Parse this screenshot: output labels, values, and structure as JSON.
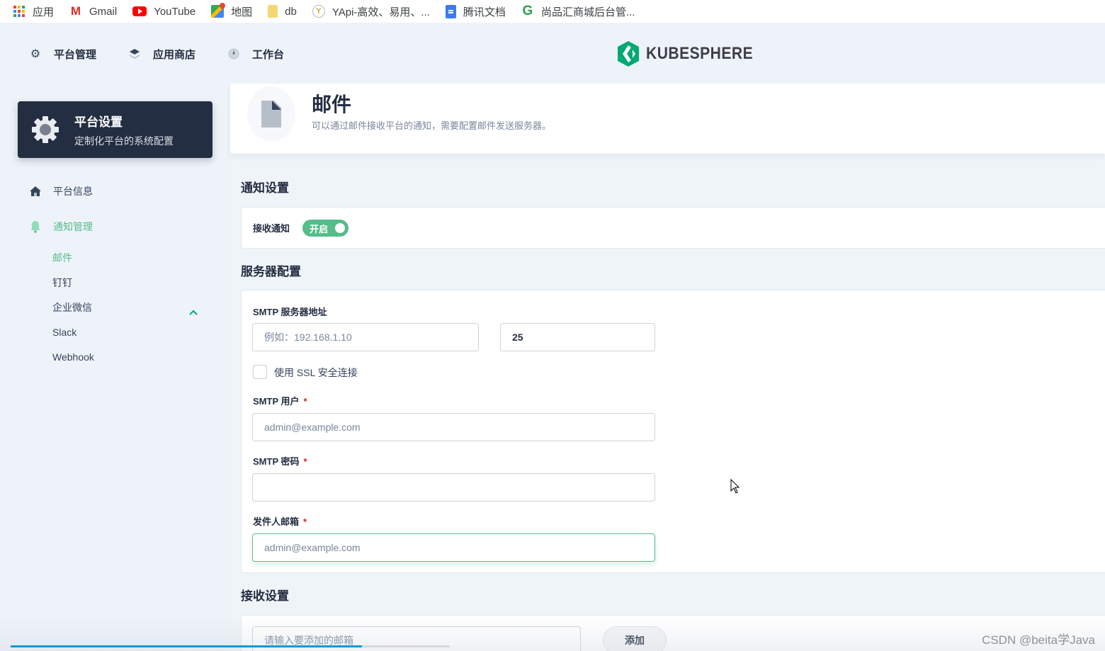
{
  "bookmarks": [
    {
      "label": "应用",
      "icon": "apps-grid-icon"
    },
    {
      "label": "Gmail",
      "icon": "gmail-icon"
    },
    {
      "label": "YouTube",
      "icon": "youtube-icon"
    },
    {
      "label": "地图",
      "icon": "maps-icon"
    },
    {
      "label": "db",
      "icon": "folder-icon"
    },
    {
      "label": "YApi-高效、易用、...",
      "icon": "yapi-icon"
    },
    {
      "label": "腾讯文档",
      "icon": "tencent-docs-icon"
    },
    {
      "label": "尚品汇商城后台管...",
      "icon": "site-favicon-icon"
    }
  ],
  "topnav": {
    "items": [
      {
        "label": "平台管理",
        "icon": "gear-icon"
      },
      {
        "label": "应用商店",
        "icon": "layers-icon"
      },
      {
        "label": "工作台",
        "icon": "dashboard-icon"
      }
    ],
    "logo_text": "KUBESPHERE"
  },
  "sidebar": {
    "card": {
      "title": "平台设置",
      "subtitle": "定制化平台的系统配置"
    },
    "items": [
      {
        "label": "平台信息",
        "icon": "home-icon"
      },
      {
        "label": "通知管理",
        "icon": "bell-icon",
        "expanded": true
      }
    ],
    "sub_items": [
      "邮件",
      "钉钉",
      "企业微信",
      "Slack",
      "Webhook"
    ],
    "active_sub": "邮件"
  },
  "page": {
    "title": "邮件",
    "description": "可以通过邮件接收平台的通知，需要配置邮件发送服务器。"
  },
  "notification": {
    "section_title": "通知设置",
    "receive_label": "接收通知",
    "switch_label": "开启",
    "switch_on": true
  },
  "server": {
    "section_title": "服务器配置",
    "smtp_address_label": "SMTP 服务器地址",
    "smtp_address_placeholder": "例如：192.168.1.10",
    "smtp_address_value": "",
    "port_value": "25",
    "ssl_label": "使用 SSL 安全连接",
    "ssl_checked": false,
    "smtp_user_label": "SMTP 用户",
    "smtp_user_placeholder": "admin@example.com",
    "smtp_password_label": "SMTP 密码",
    "smtp_password_value": "",
    "sender_label": "发件人邮箱",
    "sender_placeholder": "admin@example.com",
    "required_mark": "*"
  },
  "receive": {
    "section_title": "接收设置",
    "email_placeholder": "请输入要添加的邮箱",
    "add_label": "添加"
  },
  "video": {
    "progress_percent": 80
  },
  "watermark": "CSDN @beita学Java"
}
